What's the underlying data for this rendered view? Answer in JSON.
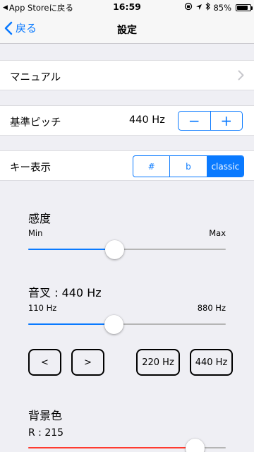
{
  "status_bar": {
    "back_app": "App Storeに戻る",
    "time": "16:59",
    "battery": "85%",
    "battery_level": 0.85
  },
  "nav": {
    "back_label": "戻る",
    "title": "設定"
  },
  "manual": {
    "label": "マニュアル"
  },
  "pitch": {
    "label": "基準ピッチ",
    "value": "440 Hz",
    "minus": "−",
    "plus": "+"
  },
  "key_display": {
    "label": "キー表示",
    "options": [
      "#",
      "b",
      "classic"
    ],
    "selected": "classic"
  },
  "sensitivity": {
    "label": "感度",
    "min": "Min",
    "max": "Max",
    "level": 0.435
  },
  "tuning_fork": {
    "label": "音叉 : 440 Hz",
    "min": "110 Hz",
    "max": "880 Hz",
    "level": 0.433,
    "buttons": {
      "prev": "<",
      "next": ">",
      "preset_220": "220 Hz",
      "preset_440": "440 Hz"
    }
  },
  "background_color": {
    "label": "背景色",
    "r_label": "R : 215",
    "r_level": 0.843
  },
  "colors": {
    "accent": "#0a7aff",
    "red": "#ff3b30"
  }
}
